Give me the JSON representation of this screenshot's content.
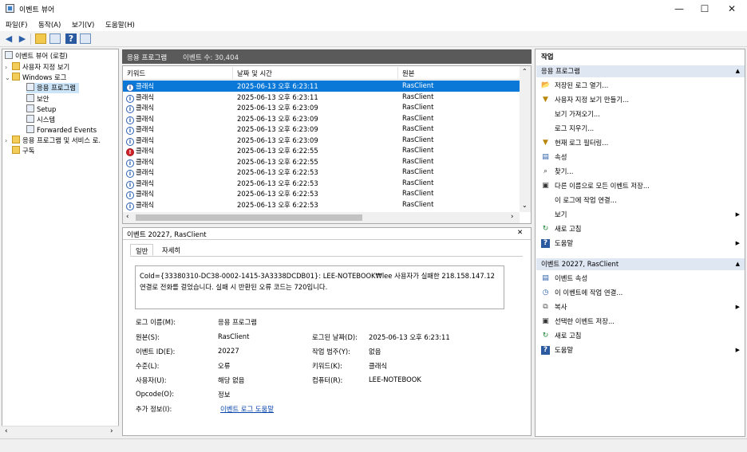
{
  "window": {
    "title": "이벤트 뷰어",
    "minimize": "—",
    "maximize": "☐",
    "close": "✕"
  },
  "menu": [
    "파일(F)",
    "동작(A)",
    "보기(V)",
    "도움말(H)"
  ],
  "tree": {
    "root": "이벤트 뷰어 (로컬)",
    "custom_views": "사용자 지정 보기",
    "windows_logs": "Windows 로그",
    "application": "응용 프로그램",
    "security": "보안",
    "setup": "Setup",
    "system": "시스템",
    "forwarded": "Forwarded Events",
    "apps_services": "응용 프로그램 및 서비스 로.",
    "subscriptions": "구독"
  },
  "grid": {
    "header_title": "응용 프로그램",
    "event_count_label": "이벤트 수: 30,404",
    "columns": [
      "키워드",
      "날짜 및 시간",
      "원본"
    ],
    "rows": [
      {
        "level": "info",
        "keyword": "클래식",
        "datetime": "2025-06-13 오후 6:23:11",
        "source": "RasClient"
      },
      {
        "level": "info",
        "keyword": "클래식",
        "datetime": "2025-06-13 오후 6:23:11",
        "source": "RasClient"
      },
      {
        "level": "info",
        "keyword": "클래식",
        "datetime": "2025-06-13 오후 6:23:09",
        "source": "RasClient"
      },
      {
        "level": "info",
        "keyword": "클래식",
        "datetime": "2025-06-13 오후 6:23:09",
        "source": "RasClient"
      },
      {
        "level": "info",
        "keyword": "클래식",
        "datetime": "2025-06-13 오후 6:23:09",
        "source": "RasClient"
      },
      {
        "level": "info",
        "keyword": "클래식",
        "datetime": "2025-06-13 오후 6:23:09",
        "source": "RasClient"
      },
      {
        "level": "error",
        "keyword": "클래식",
        "datetime": "2025-06-13 오후 6:22:55",
        "source": "RasClient"
      },
      {
        "level": "info",
        "keyword": "클래식",
        "datetime": "2025-06-13 오후 6:22:55",
        "source": "RasClient"
      },
      {
        "level": "info",
        "keyword": "클래식",
        "datetime": "2025-06-13 오후 6:22:53",
        "source": "RasClient"
      },
      {
        "level": "info",
        "keyword": "클래식",
        "datetime": "2025-06-13 오후 6:22:53",
        "source": "RasClient"
      },
      {
        "level": "info",
        "keyword": "클래식",
        "datetime": "2025-06-13 오후 6:22:53",
        "source": "RasClient"
      },
      {
        "level": "info",
        "keyword": "클래식",
        "datetime": "2025-06-13 오후 6:22:53",
        "source": "RasClient"
      }
    ]
  },
  "detail": {
    "title": "이벤트 20227, RasClient",
    "close": "✕",
    "tabs": [
      "일반",
      "자세히"
    ],
    "message": "CoId={33380310-DC38-0002-1415-3A3338DCDB01}: LEE-NOTEBOOK₩lee 사용자가 실패한 218.158.147.12 연결로 전화를 걸었습니다. 실패 시 반환된 오류 코드는 720입니다.",
    "props": {
      "log_name_label": "로그 이름(M):",
      "log_name": "응용 프로그램",
      "source_label": "원본(S):",
      "source": "RasClient",
      "logged_label": "로그된 날짜(D):",
      "logged": "2025-06-13 오후 6:23:11",
      "event_id_label": "이벤트 ID(E):",
      "event_id": "20227",
      "task_label": "작업 범주(Y):",
      "task": "없음",
      "level_label": "수준(L):",
      "level": "오류",
      "keywords_label": "키워드(K):",
      "keywords": "클래식",
      "user_label": "사용자(U):",
      "user": "해당 없음",
      "computer_label": "컴퓨터(R):",
      "computer": "LEE-NOTEBOOK",
      "opcode_label": "Opcode(O):",
      "opcode": "정보",
      "more_info_label": "추가 정보(I):",
      "more_info": "이벤트 로그 도움말"
    }
  },
  "actions": {
    "title": "작업",
    "section1": "응용 프로그램",
    "items1": [
      {
        "icon": "folder-open-icon",
        "label": "저장된 로그 열기..."
      },
      {
        "icon": "filter-icon",
        "label": "사용자 지정 보기 만들기..."
      },
      {
        "icon": "",
        "label": "보기 가져오기..."
      },
      {
        "icon": "",
        "label": "로그 지우기..."
      },
      {
        "icon": "filter-icon",
        "label": "현재 로그 필터링..."
      },
      {
        "icon": "properties-icon",
        "label": "속성"
      },
      {
        "icon": "find-icon",
        "label": "찾기..."
      },
      {
        "icon": "save-icon",
        "label": "다른 이름으로 모든 이벤트 저장..."
      },
      {
        "icon": "",
        "label": "이 로그에 작업 연결..."
      },
      {
        "icon": "",
        "label": "보기",
        "submenu": true
      },
      {
        "icon": "refresh-icon",
        "label": "새로 고침"
      },
      {
        "icon": "help-icon",
        "label": "도움말",
        "submenu": true
      }
    ],
    "section2": "이벤트 20227, RasClient",
    "items2": [
      {
        "icon": "properties-icon",
        "label": "이벤트 속성"
      },
      {
        "icon": "task-icon",
        "label": "이 이벤트에 작업 연결..."
      },
      {
        "icon": "copy-icon",
        "label": "복사",
        "submenu": true
      },
      {
        "icon": "save-icon",
        "label": "선택한 이벤트 저장..."
      },
      {
        "icon": "refresh-icon",
        "label": "새로 고침"
      },
      {
        "icon": "help-icon",
        "label": "도움말",
        "submenu": true
      }
    ]
  },
  "colors": {
    "selection": "#0a78d7",
    "error": "#d3242a",
    "header": "#5a5a5a",
    "band": "#dfe7f3"
  }
}
